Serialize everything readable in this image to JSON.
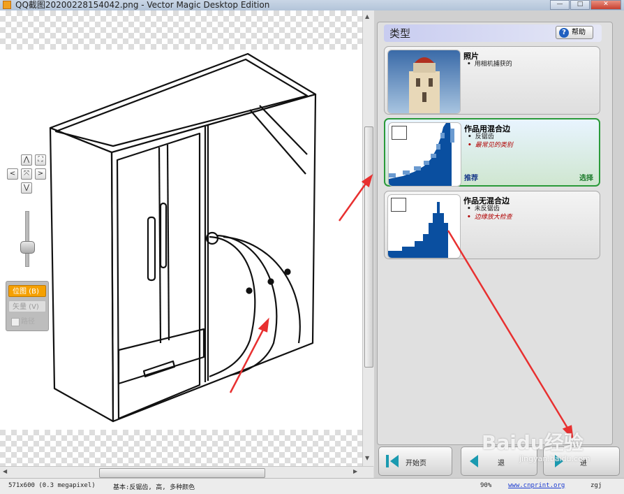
{
  "window": {
    "title": "QQ截图20200228154042.png - Vector Magic Desktop Edition",
    "buttons": [
      "—",
      "□",
      "✕"
    ]
  },
  "left_controls": {
    "up": "⋀",
    "down": "⋁",
    "left": "<",
    "right": ">",
    "center": "⤧",
    "fit": "⛶",
    "zoom_level": 0.5,
    "mode_bitmap": "位图 (B)",
    "mode_vector": "矢量 (V)",
    "mode_path": "路径"
  },
  "panel": {
    "title": "类型",
    "help": "帮助",
    "cards": [
      {
        "title": "照片",
        "bullets": [
          "用相机捕获的"
        ],
        "image": "photo-tower"
      },
      {
        "title": "作品用混合边",
        "bullets": [
          "反锯齿"
        ],
        "red_bullet": "最常见的类别",
        "recommend": "推荐",
        "select": "选择",
        "selected": true
      },
      {
        "title": "作品无混合边",
        "bullets": [
          "未反锯齿"
        ],
        "red_bullet": "边缘放大检查"
      }
    ]
  },
  "bottom": {
    "start": "开始页",
    "back": "退",
    "next": "进"
  },
  "status": {
    "size": "571x600 (0.3 megapixel)",
    "settings": "基本:反锯齿, 高, 多种颜色",
    "zoom": "90%",
    "site": "www.cnprint.org",
    "user": "zgj"
  },
  "watermark": {
    "brand": "Baidu经验",
    "url": "jingyan.baidu.com"
  },
  "colors": {
    "accent_orange": "#f5a000",
    "selected_green": "#2a9a3a",
    "annotation_red": "#e83030",
    "fill_blue": "#0a4fa0"
  }
}
